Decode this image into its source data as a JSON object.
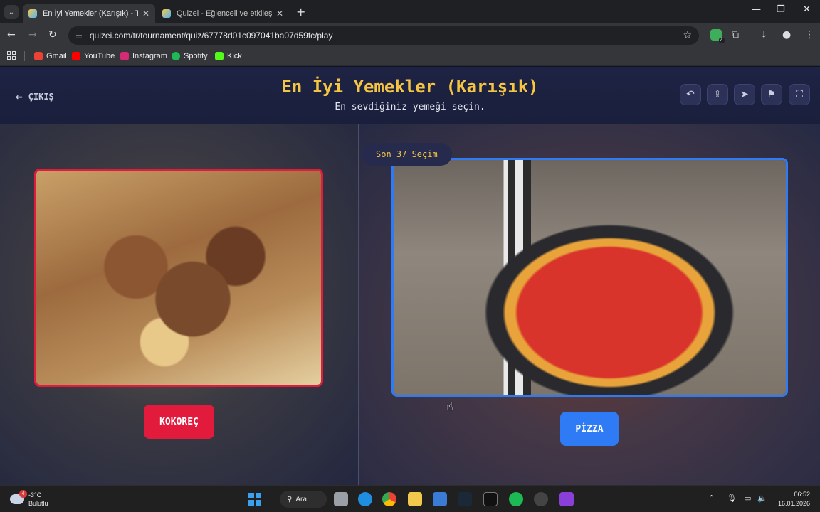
{
  "browser": {
    "tabs": [
      {
        "title": "En İyi Yemekler (Karışık) - Tier Li",
        "active": true
      },
      {
        "title": "Quizei - Eğlenceli ve etkileşimli",
        "active": false
      }
    ],
    "url": "quizei.com/tr/tournament/quiz/67778d01c097041ba07d59fc/play",
    "bookmarks": [
      "Gmail",
      "YouTube",
      "Instagram",
      "Spotify",
      "Kick"
    ],
    "extension_badge": "4"
  },
  "page": {
    "exit_label": "ÇIKIŞ",
    "title": "En İyi Yemekler (Karışık)",
    "subtitle": "En sevdiğiniz yemeği seçin.",
    "round_badge": "Son 37 Seçim",
    "left_choice": "KOKOREÇ",
    "right_choice": "PİZZA",
    "colors": {
      "accent": "#f5c542",
      "left": "#e21b3c",
      "right": "#2f7bf5"
    }
  },
  "taskbar": {
    "weather_temp": "-3°C",
    "weather_desc": "Bulutlu",
    "weather_badge": "4",
    "search_label": "Ara",
    "time": "06:52",
    "date": "16.01.2026"
  }
}
